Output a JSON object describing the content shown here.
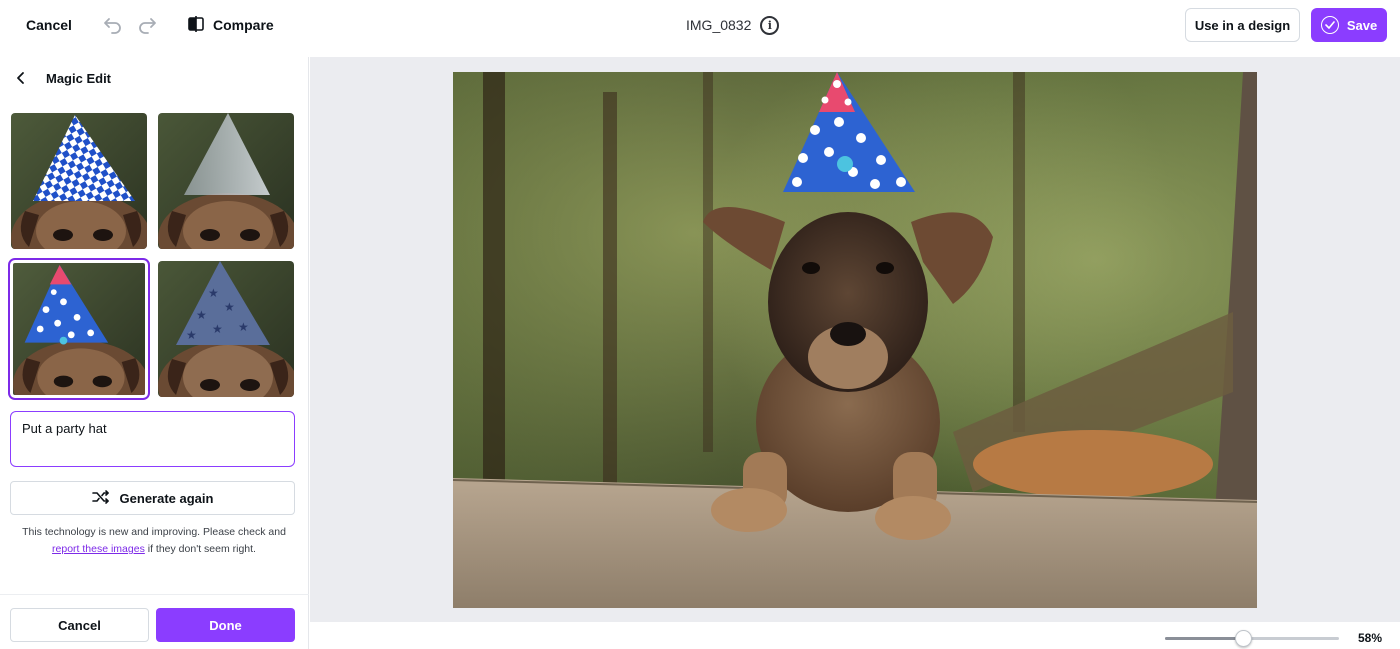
{
  "topbar": {
    "cancel_label": "Cancel",
    "compare_label": "Compare",
    "file_name": "IMG_0832",
    "info_glyph": "i",
    "use_in_design_label": "Use in a design",
    "save_label": "Save",
    "icons": [
      "undo-icon",
      "redo-icon",
      "compare-icon",
      "info-icon",
      "check-circle-icon"
    ]
  },
  "panel": {
    "title": "Magic Edit",
    "back_icon": "chevron-left-icon",
    "results": [
      {
        "name": "result-1",
        "hat": "blue-white-checked-cone",
        "selected": false
      },
      {
        "name": "result-2",
        "hat": "translucent-grey-cone",
        "selected": false
      },
      {
        "name": "result-3",
        "hat": "blue-polka-dot-cone-with-pink-tip",
        "selected": true
      },
      {
        "name": "result-4",
        "hat": "navy-star-cone",
        "selected": false
      }
    ],
    "prompt_value": "Put a party hat",
    "generate_label": "Generate again",
    "generate_icon": "shuffle-icon",
    "disclaimer_text": "This technology is new and improving. Please check and",
    "disclaimer_link": "report these images",
    "disclaimer_tail": "if they don't seem right.",
    "cancel_label": "Cancel",
    "done_label": "Done"
  },
  "zoom": {
    "label": "58%",
    "level": 0.45
  },
  "colors": {
    "accent": "#8b3dff",
    "canvas_bg": "#ebecf0",
    "link": "#7d2ae8"
  }
}
